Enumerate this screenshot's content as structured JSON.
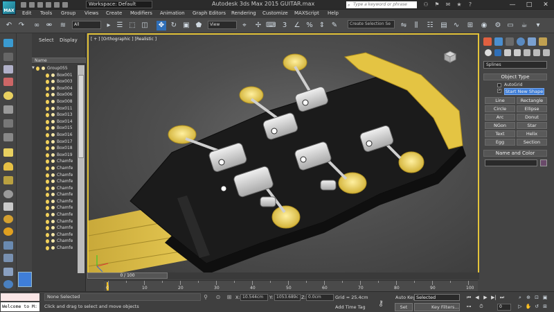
{
  "titlebar": {
    "app_logo": "MAX",
    "workspace": "Workspace: Default",
    "title": "Autodesk 3ds Max  2015     GUITAR.max",
    "help_search_placeholder": "Type a keyword or phrase",
    "minimize": "—",
    "maximize": "□",
    "close": "✕"
  },
  "menubar": {
    "items": [
      "Edit",
      "Tools",
      "Group",
      "Views",
      "Create",
      "Modifiers",
      "Animation",
      "Graph Editors",
      "Rendering",
      "Customize",
      "MAXScript",
      "Help"
    ]
  },
  "toolbar": {
    "selection_filter": "All",
    "ref_coord": "View",
    "named_selection_set": "Create Selection Se"
  },
  "explorer": {
    "tabs": [
      "Select",
      "Display"
    ],
    "column_header": "Name",
    "items": [
      {
        "label": "Group055",
        "level": 0
      },
      {
        "label": "Box001",
        "level": 1
      },
      {
        "label": "Box003",
        "level": 1
      },
      {
        "label": "Box004",
        "level": 1
      },
      {
        "label": "Box006",
        "level": 1
      },
      {
        "label": "Box008",
        "level": 1
      },
      {
        "label": "Box011",
        "level": 1
      },
      {
        "label": "Box013",
        "level": 1
      },
      {
        "label": "Box014",
        "level": 1
      },
      {
        "label": "Box015",
        "level": 1
      },
      {
        "label": "Box016",
        "level": 1
      },
      {
        "label": "Box017",
        "level": 1
      },
      {
        "label": "Box018",
        "level": 1
      },
      {
        "label": "Box019",
        "level": 1
      },
      {
        "label": "Chamfe",
        "level": 1
      },
      {
        "label": "Chamfe",
        "level": 1
      },
      {
        "label": "Chamfe",
        "level": 1
      },
      {
        "label": "Chamfe",
        "level": 1
      },
      {
        "label": "Chamfe",
        "level": 1
      },
      {
        "label": "Chamfe",
        "level": 1
      },
      {
        "label": "Chamfe",
        "level": 1
      },
      {
        "label": "Chamfe",
        "level": 1
      },
      {
        "label": "Chamfe",
        "level": 1
      },
      {
        "label": "Chamfe",
        "level": 1
      },
      {
        "label": "Chamfe",
        "level": 1
      },
      {
        "label": "Chamfe",
        "level": 1
      },
      {
        "label": "Chamfe",
        "level": 1
      },
      {
        "label": "Chamfe",
        "level": 1
      }
    ]
  },
  "viewport": {
    "label": "[ + ] [Orthographic ] [Realistic ]"
  },
  "command_panel": {
    "category": "Splines",
    "object_type_title": "Object Type",
    "autogrid_label": "AutoGrid",
    "start_new_shape_label": "Start New Shape",
    "buttons": [
      "Line",
      "Rectangle",
      "Circle",
      "Ellipse",
      "Arc",
      "Donut",
      "NGon",
      "Star",
      "Text",
      "Helix",
      "Egg",
      "Section"
    ],
    "name_color_title": "Name and Color",
    "checkmark": "✓"
  },
  "timeline": {
    "slider_label": "0 / 100",
    "ticks": [
      "0",
      "10",
      "20",
      "30",
      "40",
      "50",
      "60",
      "70",
      "80",
      "90",
      "100"
    ]
  },
  "statusbar": {
    "welcome": "Welcome to M:",
    "selection": "None Selected",
    "prompt": "Click and drag to select and move objects",
    "x_label": "X:",
    "x_value": "10.544cm",
    "y_label": "Y:",
    "y_value": "1053.689c",
    "z_label": "Z:",
    "z_value": "0.0cm",
    "grid": "Grid = 25.4cm",
    "add_time_tag": "Add Time Tag",
    "auto_key": "Auto Key",
    "selected": "Selected",
    "set_key": "Set Key",
    "key_filters": "Key Filters...",
    "frame": "0"
  },
  "colors": {
    "viewport_border": "#e4c43a",
    "active_tool": "#2f6fb8",
    "guitar_yellow": "#e7c443",
    "headstock_black": "#1a1a1a"
  }
}
